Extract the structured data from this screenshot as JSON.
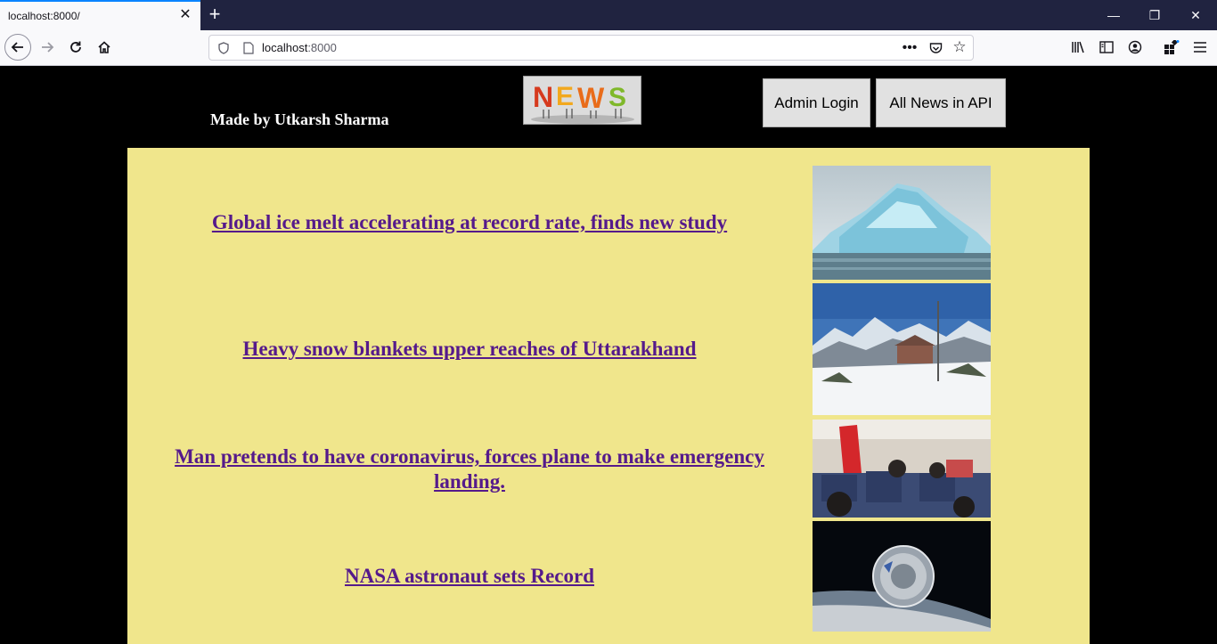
{
  "browser": {
    "tab_title": "localhost:8000/",
    "url_host": "localhost",
    "url_port": ":8000"
  },
  "header": {
    "author": "Made by Utkarsh Sharma",
    "logo_text": "NEWS",
    "admin_login_label": "Admin Login",
    "all_news_label": "All News in API"
  },
  "news": [
    {
      "headline": "Global ice melt accelerating at record rate, finds new study",
      "image": "iceberg-photo"
    },
    {
      "headline": "Heavy snow blankets upper reaches of Uttarakhand",
      "image": "snowy-mountains-photo"
    },
    {
      "headline": "Man pretends to have coronavirus, forces plane to make emergency landing.",
      "image": "airplane-cabin-photo"
    },
    {
      "headline": "NASA astronaut sets Record",
      "image": "space-capsule-photo"
    }
  ],
  "colors": {
    "page_background": "#000000",
    "news_background": "#f0e68c",
    "link": "#551a8b"
  }
}
